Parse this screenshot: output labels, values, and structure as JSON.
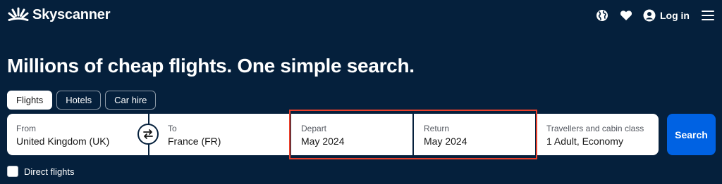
{
  "header": {
    "brand": "Skyscanner",
    "icons": [
      "globe-icon",
      "heart-icon",
      "user-icon",
      "hamburger-menu-icon"
    ],
    "login_label": "Log in"
  },
  "headline": "Millions of cheap flights. One simple search.",
  "tabs": [
    {
      "label": "Flights",
      "active": true
    },
    {
      "label": "Hotels",
      "active": false
    },
    {
      "label": "Car hire",
      "active": false
    }
  ],
  "search": {
    "from": {
      "label": "From",
      "value": "United Kingdom (UK)"
    },
    "to": {
      "label": "To",
      "value": "France (FR)"
    },
    "depart": {
      "label": "Depart",
      "value": "May 2024"
    },
    "return": {
      "label": "Return",
      "value": "May 2024"
    },
    "travellers": {
      "label": "Travellers and cabin class",
      "value": "1 Adult, Economy"
    },
    "search_label": "Search"
  },
  "direct_flights": {
    "label": "Direct flights",
    "checked": false
  },
  "colors": {
    "background": "#05203c",
    "primary_button": "#0062e3",
    "highlight_box": "#e8402b"
  }
}
